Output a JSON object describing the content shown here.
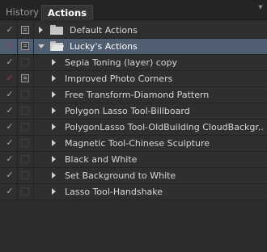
{
  "tabs": [
    {
      "label": "History",
      "active": false
    },
    {
      "label": "Actions",
      "active": true
    }
  ],
  "colors": {
    "selected_row": "#4f5e70",
    "excluded_check": "#b83a3a",
    "check": "#a8a8a8"
  },
  "rows": [
    {
      "label": "Default Actions",
      "type": "set",
      "expanded": false,
      "selected": false,
      "check": "gray",
      "dialog": true
    },
    {
      "label": "Lucky's Actions",
      "type": "set",
      "expanded": true,
      "selected": true,
      "check": "red",
      "dialog": true
    },
    {
      "label": "Sepia Toning (layer) copy",
      "type": "action",
      "check": "gray",
      "dialog": false
    },
    {
      "label": "Improved Photo Corners",
      "type": "action",
      "check": "red",
      "dialog": true
    },
    {
      "label": "Free Transform-Diamond Pattern",
      "type": "action",
      "check": "gray",
      "dialog": false
    },
    {
      "label": "Polygon Lasso Tool-Billboard",
      "type": "action",
      "check": "gray",
      "dialog": false
    },
    {
      "label": "PolygonLasso Tool-OldBuilding CloudBackgr...",
      "type": "action",
      "check": "gray",
      "dialog": false
    },
    {
      "label": "Magnetic Tool-Chinese Sculpture",
      "type": "action",
      "check": "gray",
      "dialog": false
    },
    {
      "label": "Black and White",
      "type": "action",
      "check": "gray",
      "dialog": false
    },
    {
      "label": "Set Background to White",
      "type": "action",
      "check": "gray",
      "dialog": false
    },
    {
      "label": "Lasso Tool-Handshake",
      "type": "action",
      "check": "gray",
      "dialog": false
    }
  ]
}
